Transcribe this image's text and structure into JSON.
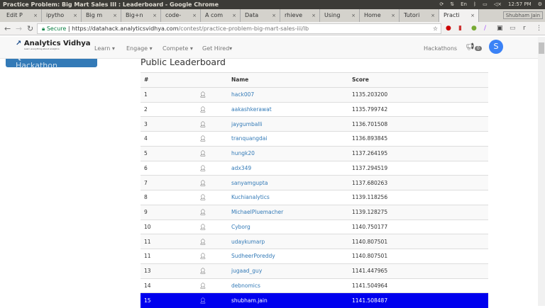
{
  "window": {
    "title": "Practice Problem: Big Mart Sales III : Leaderboard - Google Chrome",
    "time": "12:57 PM",
    "lang": "En"
  },
  "tabs": [
    {
      "label": "Edit P"
    },
    {
      "label": "ipytho"
    },
    {
      "label": "Big m"
    },
    {
      "label": "Big+n"
    },
    {
      "label": "code-"
    },
    {
      "label": "A com"
    },
    {
      "label": "Data"
    },
    {
      "label": "rhieve"
    },
    {
      "label": "Using"
    },
    {
      "label": "Home"
    },
    {
      "label": "Tutori"
    },
    {
      "label": "Practi",
      "active": true
    }
  ],
  "profile": "Shubham Jain",
  "address": {
    "secure": "Secure",
    "host": "https://datahack.analyticsvidhya.com",
    "path": "/contest/practice-problem-big-mart-sales-iii/lb"
  },
  "site": {
    "logo": "Analytics Vidhya",
    "tagline": "Learn everything about analytics",
    "menu": [
      "Learn ▾",
      "Engage ▾",
      "Compete ▾",
      "Get Hired▾"
    ],
    "hackathons": "Hackathons",
    "notif_count": "0",
    "avatar": "S",
    "accent": "#337ab7",
    "highlight": "#0000ee"
  },
  "back_button": "❮ Back to Hackathon",
  "leaderboard": {
    "title": "Public Leaderboard",
    "headers": [
      "#",
      "",
      "Name",
      "Score"
    ],
    "rows": [
      [
        "1",
        "hack007",
        "1135.203200"
      ],
      [
        "2",
        "aakashkerawat",
        "1135.799742"
      ],
      [
        "3",
        "jaygumballi",
        "1136.701508"
      ],
      [
        "4",
        "tranquangdai",
        "1136.893845"
      ],
      [
        "5",
        "hungk20",
        "1137.264195"
      ],
      [
        "6",
        "adx349",
        "1137.294519"
      ],
      [
        "7",
        "sanyamgupta",
        "1137.680263"
      ],
      [
        "8",
        "Kuchianalytics",
        "1139.118256"
      ],
      [
        "9",
        "MichaelPluemacher",
        "1139.128275"
      ],
      [
        "10",
        "Cyborg",
        "1140.750177"
      ],
      [
        "11",
        "udaykumarp",
        "1140.807501"
      ],
      [
        "11",
        "SudheerPoreddy",
        "1140.807501"
      ],
      [
        "13",
        "jugaad_guy",
        "1141.447965"
      ],
      [
        "14",
        "debnomics",
        "1141.504964"
      ],
      [
        "15",
        "shubham.jain",
        "1141.508487"
      ]
    ],
    "highlighted_row": "15"
  }
}
